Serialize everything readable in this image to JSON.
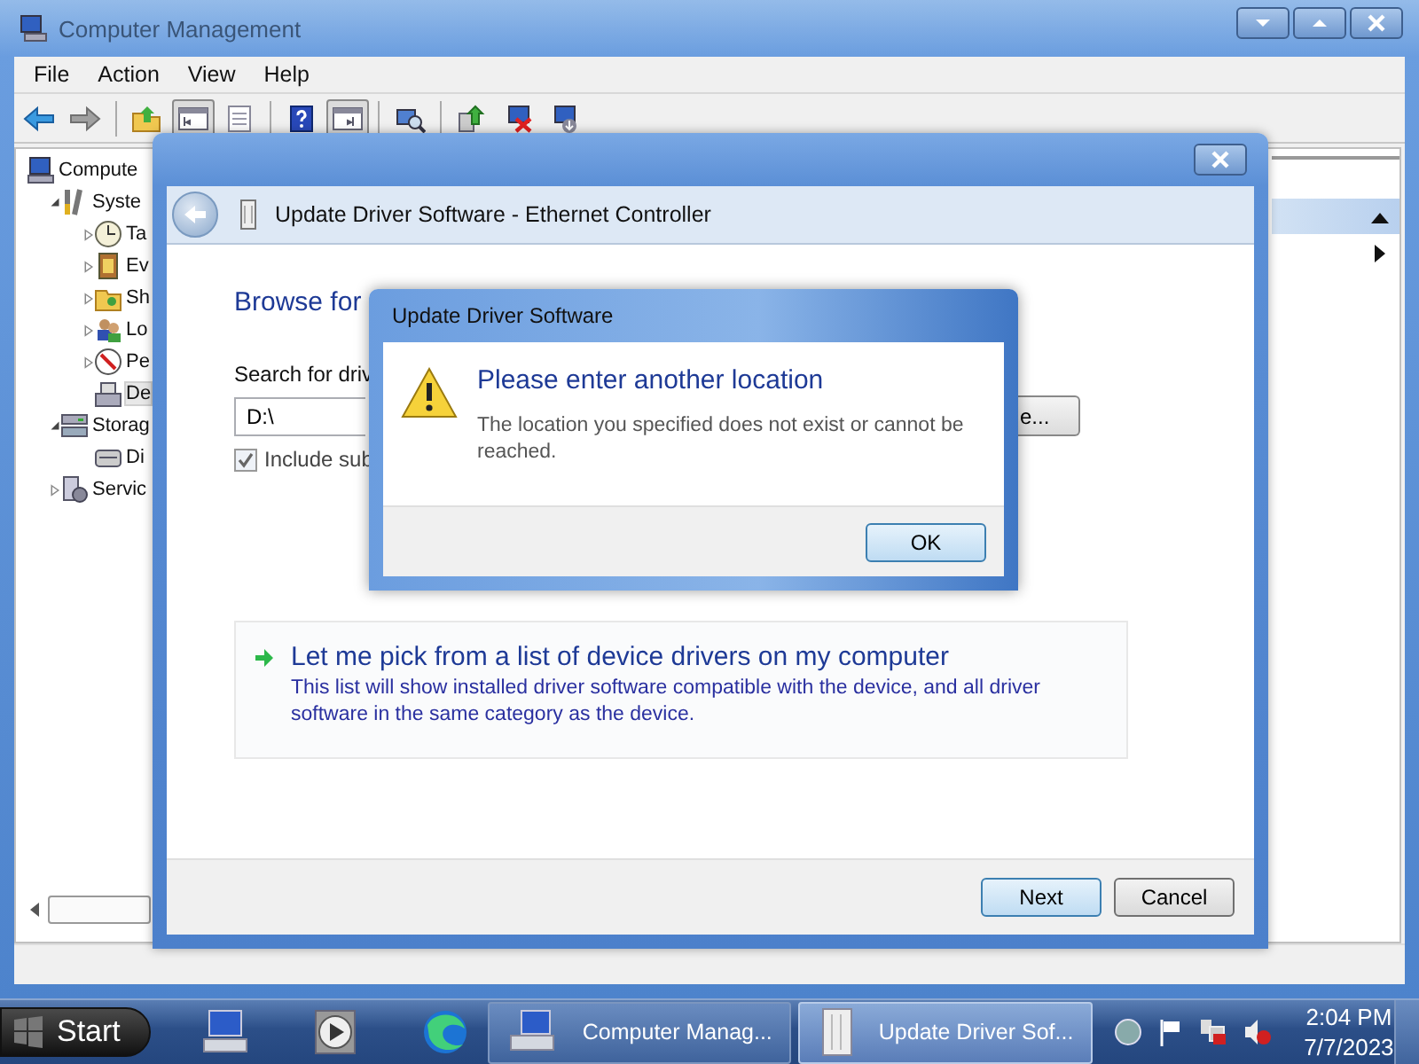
{
  "main_window": {
    "title": "Computer Management",
    "active": false,
    "menu": [
      "File",
      "Action",
      "View",
      "Help"
    ],
    "toolbar": [
      [
        {
          "kind": "back",
          "pressed": false
        },
        {
          "kind": "forward",
          "pressed": false
        }
      ],
      [
        {
          "kind": "up",
          "pressed": false
        },
        {
          "kind": "tree",
          "pressed": true
        },
        {
          "kind": "list",
          "pressed": false
        }
      ],
      [
        {
          "kind": "help",
          "pressed": false
        },
        {
          "kind": "pane",
          "pressed": true
        }
      ],
      [
        {
          "kind": "scan",
          "pressed": false
        }
      ],
      [
        {
          "kind": "update",
          "pressed": false
        },
        {
          "kind": "uninstall",
          "pressed": false
        },
        {
          "kind": "enable",
          "pressed": false
        }
      ]
    ],
    "tree": [
      {
        "label": "Compute",
        "kind": "computer",
        "selected": false,
        "children": [
          {
            "label": "Syste",
            "kind": "tools",
            "expanded": true,
            "selected": false,
            "children": [
              {
                "label": "Ta",
                "kind": "clock",
                "expanded": false,
                "selected": false
              },
              {
                "label": "Ev",
                "kind": "event",
                "expanded": false,
                "selected": false
              },
              {
                "label": "Sh",
                "kind": "share",
                "expanded": false,
                "selected": false
              },
              {
                "label": "Lo",
                "kind": "users",
                "expanded": false,
                "selected": false
              },
              {
                "label": "Pe",
                "kind": "perf",
                "expanded": false,
                "selected": false
              },
              {
                "label": "De",
                "kind": "device",
                "selected": true
              }
            ]
          },
          {
            "label": "Storag",
            "kind": "storage",
            "expanded": true,
            "selected": false,
            "children": [
              {
                "label": "Di",
                "kind": "disk",
                "selected": false
              }
            ]
          },
          {
            "label": "Servic",
            "kind": "services",
            "expanded": false,
            "selected": false
          }
        ]
      }
    ]
  },
  "wizard": {
    "title": "Update Driver Software - Ethernet Controller",
    "heading": "Browse for",
    "search_label": "Search for driv",
    "path": "D:\\",
    "browse_button": "e...",
    "include_subfolders": {
      "label": "Include sub",
      "checked": true
    },
    "option": {
      "title": "Let me pick from a list of device drivers on my computer",
      "description": "This list will show installed driver software compatible with the device, and all driver software in the same category as the device."
    },
    "buttons": [
      {
        "label": "Next",
        "default": true
      },
      {
        "label": "Cancel",
        "default": false
      }
    ]
  },
  "dialog": {
    "title": "Update Driver Software",
    "heading": "Please enter another location",
    "message": "The location you specified does not exist or cannot be reached.",
    "button": "OK"
  },
  "taskbar": {
    "start": "Start",
    "pinned": [
      {
        "kind": "computer"
      },
      {
        "kind": "media"
      },
      {
        "kind": "browser"
      }
    ],
    "tasks": [
      {
        "label": "Computer Manag...",
        "kind": "mmc",
        "selected": false
      },
      {
        "label": "Update Driver Sof...",
        "kind": "device",
        "selected": true
      }
    ],
    "tray": [
      {
        "kind": "globe"
      },
      {
        "kind": "flag"
      },
      {
        "kind": "network"
      },
      {
        "kind": "speaker"
      }
    ],
    "time": "2:04 PM",
    "date": "7/7/2023"
  }
}
